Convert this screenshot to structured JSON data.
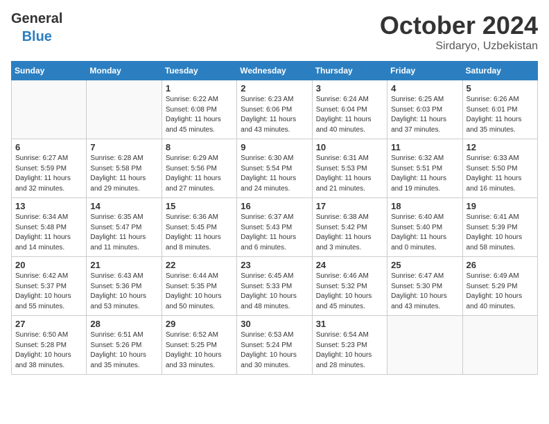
{
  "header": {
    "logo_general": "General",
    "logo_blue": "Blue",
    "month": "October 2024",
    "location": "Sirdaryo, Uzbekistan"
  },
  "weekdays": [
    "Sunday",
    "Monday",
    "Tuesday",
    "Wednesday",
    "Thursday",
    "Friday",
    "Saturday"
  ],
  "weeks": [
    [
      {
        "day": null
      },
      {
        "day": null
      },
      {
        "day": "1",
        "sunrise": "6:22 AM",
        "sunset": "6:08 PM",
        "daylight": "11 hours and 45 minutes."
      },
      {
        "day": "2",
        "sunrise": "6:23 AM",
        "sunset": "6:06 PM",
        "daylight": "11 hours and 43 minutes."
      },
      {
        "day": "3",
        "sunrise": "6:24 AM",
        "sunset": "6:04 PM",
        "daylight": "11 hours and 40 minutes."
      },
      {
        "day": "4",
        "sunrise": "6:25 AM",
        "sunset": "6:03 PM",
        "daylight": "11 hours and 37 minutes."
      },
      {
        "day": "5",
        "sunrise": "6:26 AM",
        "sunset": "6:01 PM",
        "daylight": "11 hours and 35 minutes."
      }
    ],
    [
      {
        "day": "6",
        "sunrise": "6:27 AM",
        "sunset": "5:59 PM",
        "daylight": "11 hours and 32 minutes."
      },
      {
        "day": "7",
        "sunrise": "6:28 AM",
        "sunset": "5:58 PM",
        "daylight": "11 hours and 29 minutes."
      },
      {
        "day": "8",
        "sunrise": "6:29 AM",
        "sunset": "5:56 PM",
        "daylight": "11 hours and 27 minutes."
      },
      {
        "day": "9",
        "sunrise": "6:30 AM",
        "sunset": "5:54 PM",
        "daylight": "11 hours and 24 minutes."
      },
      {
        "day": "10",
        "sunrise": "6:31 AM",
        "sunset": "5:53 PM",
        "daylight": "11 hours and 21 minutes."
      },
      {
        "day": "11",
        "sunrise": "6:32 AM",
        "sunset": "5:51 PM",
        "daylight": "11 hours and 19 minutes."
      },
      {
        "day": "12",
        "sunrise": "6:33 AM",
        "sunset": "5:50 PM",
        "daylight": "11 hours and 16 minutes."
      }
    ],
    [
      {
        "day": "13",
        "sunrise": "6:34 AM",
        "sunset": "5:48 PM",
        "daylight": "11 hours and 14 minutes."
      },
      {
        "day": "14",
        "sunrise": "6:35 AM",
        "sunset": "5:47 PM",
        "daylight": "11 hours and 11 minutes."
      },
      {
        "day": "15",
        "sunrise": "6:36 AM",
        "sunset": "5:45 PM",
        "daylight": "11 hours and 8 minutes."
      },
      {
        "day": "16",
        "sunrise": "6:37 AM",
        "sunset": "5:43 PM",
        "daylight": "11 hours and 6 minutes."
      },
      {
        "day": "17",
        "sunrise": "6:38 AM",
        "sunset": "5:42 PM",
        "daylight": "11 hours and 3 minutes."
      },
      {
        "day": "18",
        "sunrise": "6:40 AM",
        "sunset": "5:40 PM",
        "daylight": "11 hours and 0 minutes."
      },
      {
        "day": "19",
        "sunrise": "6:41 AM",
        "sunset": "5:39 PM",
        "daylight": "10 hours and 58 minutes."
      }
    ],
    [
      {
        "day": "20",
        "sunrise": "6:42 AM",
        "sunset": "5:37 PM",
        "daylight": "10 hours and 55 minutes."
      },
      {
        "day": "21",
        "sunrise": "6:43 AM",
        "sunset": "5:36 PM",
        "daylight": "10 hours and 53 minutes."
      },
      {
        "day": "22",
        "sunrise": "6:44 AM",
        "sunset": "5:35 PM",
        "daylight": "10 hours and 50 minutes."
      },
      {
        "day": "23",
        "sunrise": "6:45 AM",
        "sunset": "5:33 PM",
        "daylight": "10 hours and 48 minutes."
      },
      {
        "day": "24",
        "sunrise": "6:46 AM",
        "sunset": "5:32 PM",
        "daylight": "10 hours and 45 minutes."
      },
      {
        "day": "25",
        "sunrise": "6:47 AM",
        "sunset": "5:30 PM",
        "daylight": "10 hours and 43 minutes."
      },
      {
        "day": "26",
        "sunrise": "6:49 AM",
        "sunset": "5:29 PM",
        "daylight": "10 hours and 40 minutes."
      }
    ],
    [
      {
        "day": "27",
        "sunrise": "6:50 AM",
        "sunset": "5:28 PM",
        "daylight": "10 hours and 38 minutes."
      },
      {
        "day": "28",
        "sunrise": "6:51 AM",
        "sunset": "5:26 PM",
        "daylight": "10 hours and 35 minutes."
      },
      {
        "day": "29",
        "sunrise": "6:52 AM",
        "sunset": "5:25 PM",
        "daylight": "10 hours and 33 minutes."
      },
      {
        "day": "30",
        "sunrise": "6:53 AM",
        "sunset": "5:24 PM",
        "daylight": "10 hours and 30 minutes."
      },
      {
        "day": "31",
        "sunrise": "6:54 AM",
        "sunset": "5:23 PM",
        "daylight": "10 hours and 28 minutes."
      },
      {
        "day": null
      },
      {
        "day": null
      }
    ]
  ]
}
